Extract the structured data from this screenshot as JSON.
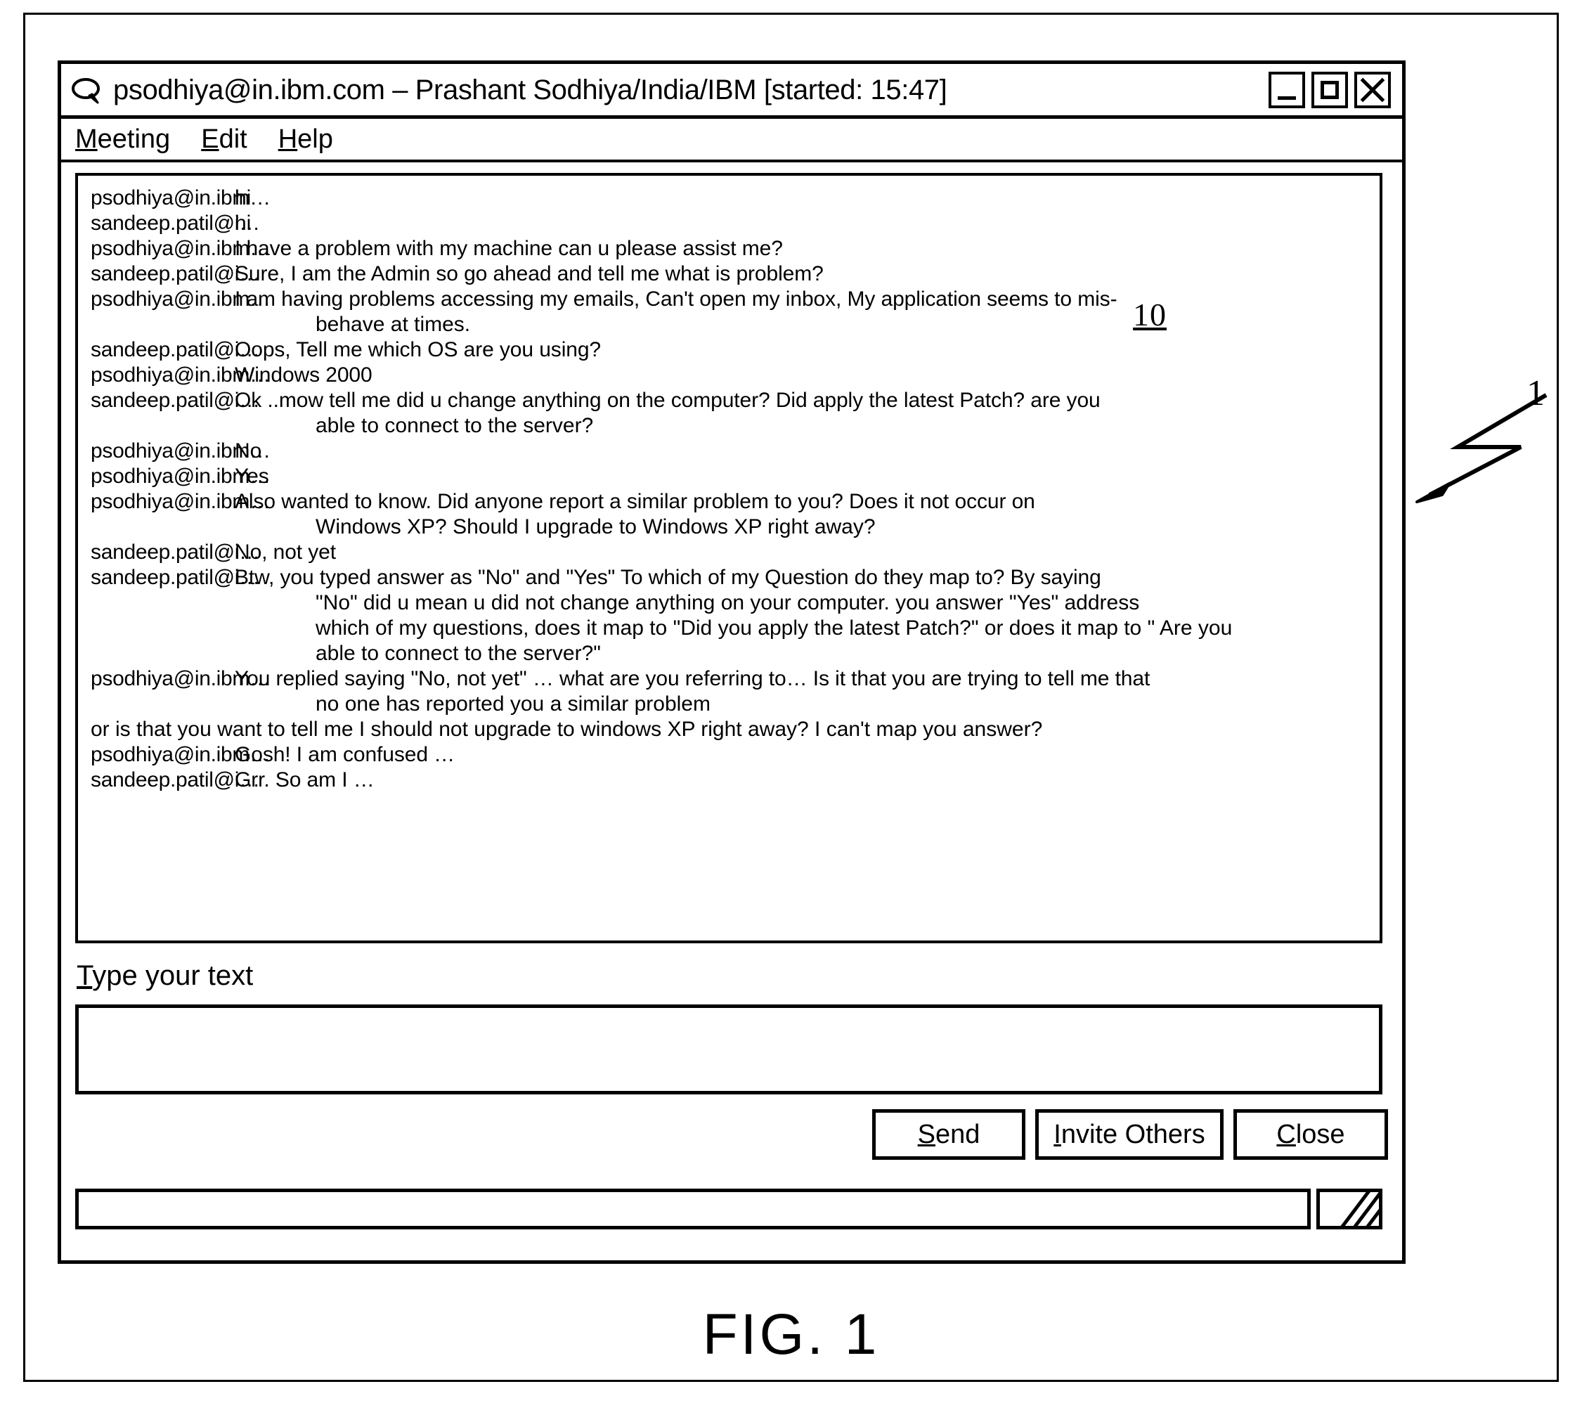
{
  "window": {
    "title": "psodhiya@in.ibm.com – Prashant Sodhiya/India/IBM [started: 15:47]",
    "icon": "chat-bubble-icon",
    "controls": {
      "minimize": "minimize-icon",
      "maximize": "maximize-icon",
      "close": "close-icon"
    }
  },
  "menubar": {
    "items": [
      {
        "label": "Meeting",
        "accelerator": "M"
      },
      {
        "label": "Edit",
        "accelerator": "E"
      },
      {
        "label": "Help",
        "accelerator": "H"
      }
    ]
  },
  "transcript": {
    "speakers": {
      "a": "psodhiya@in.ibm…",
      "b": "sandeep.patil@i…"
    },
    "lines": [
      {
        "type": "msg",
        "speaker": "psodhiya@in.ibm…",
        "text": "hi"
      },
      {
        "type": "msg",
        "speaker": "sandeep.patil@i…",
        "text": "hi"
      },
      {
        "type": "msg",
        "speaker": "psodhiya@in.ibm…",
        "text": "I have a problem with my machine can u please assist me?"
      },
      {
        "type": "msg",
        "speaker": "sandeep.patil@i…",
        "text": "Sure, I am the Admin so go ahead and tell me what is problem?"
      },
      {
        "type": "msg",
        "speaker": "psodhiya@in.ibm…",
        "text": "I am having problems accessing my emails, Can't open my inbox, My application seems to mis-"
      },
      {
        "type": "cont",
        "text": "behave at times."
      },
      {
        "type": "msg",
        "speaker": "sandeep.patil@i…",
        "text": "Oops, Tell me which OS are you using?"
      },
      {
        "type": "msg",
        "speaker": "psodhiya@in.ibm…",
        "text": "Windows 2000"
      },
      {
        "type": "msg",
        "speaker": "sandeep.patil@i…",
        "text": "Ok ..mow tell me did u change anything on the computer? Did apply the latest Patch? are you"
      },
      {
        "type": "cont",
        "text": "able to connect to the server?"
      },
      {
        "type": "msg",
        "speaker": "psodhiya@in.ibm…",
        "text": "No"
      },
      {
        "type": "msg",
        "speaker": "psodhiya@in.ibm…",
        "text": "Yes"
      },
      {
        "type": "msg",
        "speaker": "psodhiya@in.ibm…",
        "text": "Also wanted to know. Did anyone report a similar problem to you? Does it not occur on"
      },
      {
        "type": "cont",
        "text": "Windows XP? Should I upgrade to Windows XP right away?"
      },
      {
        "type": "msg",
        "speaker": "sandeep.patil@i…",
        "text": "No, not yet"
      },
      {
        "type": "msg",
        "speaker": "sandeep.patil@i…",
        "text": "Btw, you typed answer as \"No\" and \"Yes\" To which of my Question do they map to? By saying"
      },
      {
        "type": "cont",
        "text": "\"No\" did u mean u did not change anything on your computer. you answer \"Yes\" address"
      },
      {
        "type": "cont",
        "text": "which of my questions, does it map to \"Did you apply the latest Patch?\" or does it map to \" Are you"
      },
      {
        "type": "cont",
        "text": "able to connect to the server?\""
      },
      {
        "type": "msg",
        "speaker": "psodhiya@in.ibm…",
        "text": "You replied saying \"No, not yet\" … what are you referring to… Is it that you are trying to tell me that"
      },
      {
        "type": "cont",
        "text": "no one has reported you a similar problem"
      },
      {
        "type": "full",
        "text": "or is that you want to tell me I should not upgrade to windows XP right away? I can't map you answer?"
      },
      {
        "type": "msg",
        "speaker": "psodhiya@in.ibm…",
        "text": "Gosh! I am confused …"
      },
      {
        "type": "msg",
        "speaker": "sandeep.patil@i…",
        "text": "Grr. So am I …"
      }
    ]
  },
  "compose": {
    "label": "Type your text",
    "label_accelerator": "T",
    "value": "",
    "placeholder": ""
  },
  "buttons": [
    {
      "label": "Send",
      "accelerator": "S"
    },
    {
      "label": "Invite Others",
      "accelerator": "I"
    },
    {
      "label": "Close",
      "accelerator": "C"
    }
  ],
  "statusbar": {
    "text": "",
    "grip": "resize-grip-icon"
  },
  "annotations": {
    "ref_chat_window": "10",
    "ref_figure": "1",
    "figure_caption": "FIG. 1"
  }
}
